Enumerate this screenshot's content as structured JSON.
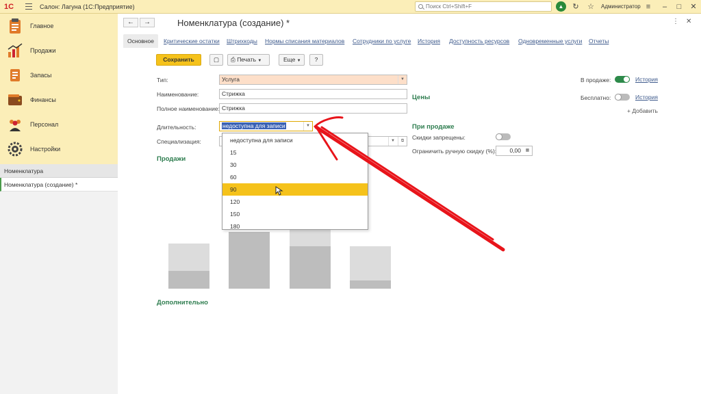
{
  "app": {
    "logo": "1С",
    "title": "Салон: Лагуна  (1С:Предприятие)",
    "search_placeholder": "Поиск Ctrl+Shift+F",
    "user": "Администратор"
  },
  "sidebar": {
    "items": [
      {
        "label": "Главное"
      },
      {
        "label": "Продажи"
      },
      {
        "label": "Запасы"
      },
      {
        "label": "Финансы"
      },
      {
        "label": "Персонал"
      },
      {
        "label": "Настройки"
      }
    ],
    "nav_header": "Номенклатура",
    "nav_active": "Номенклатура (создание) *"
  },
  "form": {
    "title": "Номенклатура (создание) *",
    "tabs": [
      {
        "label": "Основное"
      },
      {
        "label": "Критические остатки"
      },
      {
        "label": "Штрихкоды"
      },
      {
        "label": "Нормы списания материалов"
      },
      {
        "label": "Сотрудники по услуге"
      },
      {
        "label": "История"
      },
      {
        "label": "Доступность ресурсов"
      },
      {
        "label": "Одновременные услуги"
      },
      {
        "label": "Отчеты"
      }
    ],
    "toolbar": {
      "save": "Сохранить",
      "print": "Печать",
      "more": "Еще",
      "help": "?"
    },
    "fields": {
      "type_label": "Тип:",
      "type_value": "Услуга",
      "name_label": "Наименование:",
      "name_value": "Стрижка",
      "fullname_label": "Полное наименование:",
      "fullname_value": "Стрижка",
      "duration_label": "Длительность:",
      "duration_value": "недоступна для записи",
      "spec_label": "Специализация:"
    },
    "sections": {
      "prices": "Цены",
      "on_sale_section": "При продаже",
      "sales": "Продажи",
      "additional": "Дополнительно"
    },
    "right": {
      "on_sale_label": "В продаже:",
      "on_sale_history": "История",
      "free_label": "Бесплатно:",
      "free_history": "История",
      "add": "+ Добавить",
      "discounts_label": "Скидки запрещены:",
      "limit_label": "Ограничить ручную скидку (%):",
      "limit_value": "0,00"
    },
    "dropdown_options": [
      "недоступна для записи",
      "15",
      "30",
      "60",
      "90",
      "120",
      "150",
      "180"
    ],
    "dropdown_highlighted": "90"
  },
  "colors": {
    "accent_yellow": "#f5c21b",
    "section_green": "#2e7d4f",
    "annotation_red": "#e8141a"
  }
}
